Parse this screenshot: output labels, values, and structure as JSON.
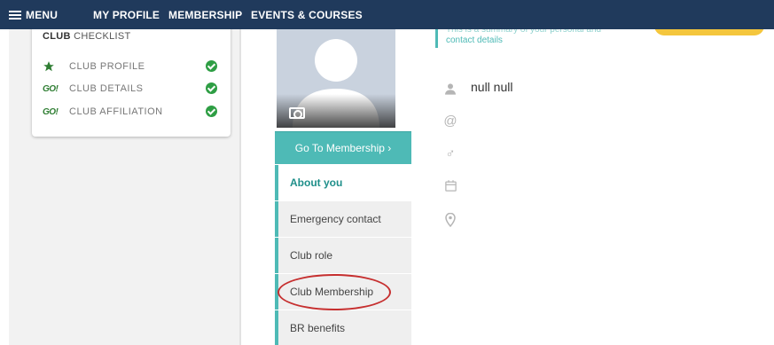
{
  "nav": {
    "menu_label": "MENU",
    "items": [
      "MY PROFILE",
      "MEMBERSHIP",
      "EVENTS & COURSES"
    ]
  },
  "checklist": {
    "title_bold": "CLUB",
    "title_rest": " CHECKLIST",
    "items": [
      {
        "icon": "star-icon",
        "label": "CLUB PROFILE",
        "status": "complete"
      },
      {
        "icon": "go-icon",
        "icon_text": "GO!",
        "label": "CLUB DETAILS",
        "status": "complete"
      },
      {
        "icon": "go-icon",
        "icon_text": "GO!",
        "label": "CLUB AFFILIATION",
        "status": "complete"
      }
    ]
  },
  "profile": {
    "go_to_membership": "Go To Membership ›",
    "menu": [
      "About you",
      "Emergency contact",
      "Club role",
      "Club Membership",
      "BR benefits"
    ],
    "active_item": "About you",
    "highlighted_item": "Club Membership"
  },
  "summary": {
    "line1": "This is a summary of your personal and",
    "line2": "contact details"
  },
  "details": {
    "name": "null null"
  },
  "colors": {
    "nav_bg": "#203a5c",
    "accent": "#4ebab6",
    "check_green": "#2e9e44",
    "highlight_oval": "#c62f2f",
    "button_yellow": "#f4c63d"
  }
}
